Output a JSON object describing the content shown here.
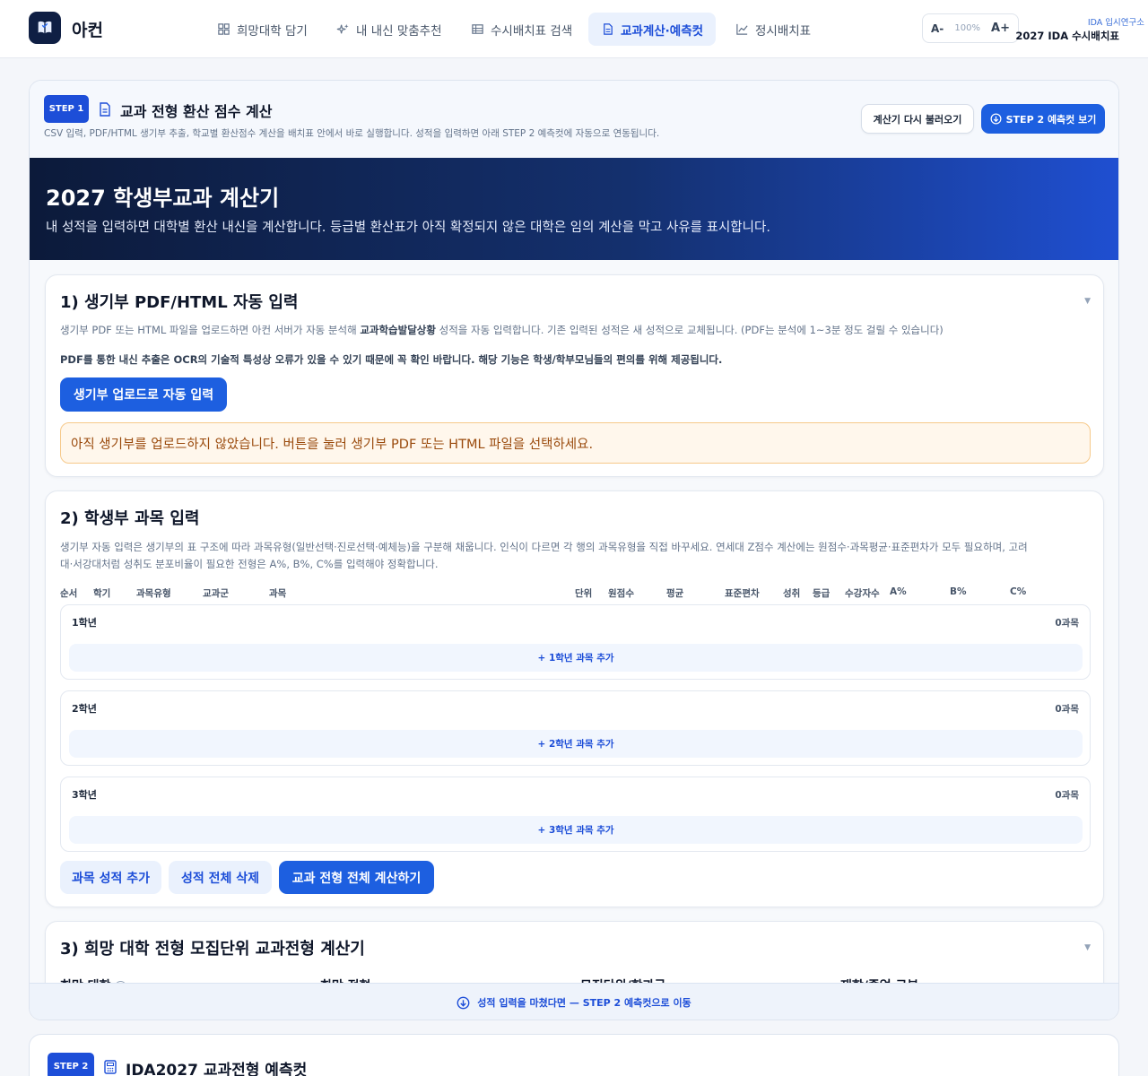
{
  "header": {
    "app_name": "아컨",
    "nav": [
      {
        "label": "희망대학 담기",
        "icon": "grid-icon"
      },
      {
        "label": "내 내신 맞춤추천",
        "icon": "sparkle-icon"
      },
      {
        "label": "수시배치표 검색",
        "icon": "table-icon"
      },
      {
        "label": "교과계산·예측컷",
        "icon": "document-calc-icon",
        "active": true
      },
      {
        "label": "정시배치표",
        "icon": "line-chart-icon"
      }
    ],
    "zoom": {
      "decrease": "A-",
      "value": "100%",
      "increase": "A+"
    },
    "brand_sub": "IDA 입시연구소",
    "brand_main": "2027 IDA 수시배치표"
  },
  "step1": {
    "badge": "STEP 1",
    "title": "교과 전형 환산 점수 계산",
    "desc": "CSV 입력, PDF/HTML 생기부 추출, 학교별 환산점수 계산을 배치표 안에서 바로 실행합니다. 성적을 입력하면 아래 STEP 2 예측컷에 자동으로 연동됩니다.",
    "reload_button": "계산기 다시 불러오기",
    "step2_button": "STEP 2 예측컷 보기"
  },
  "hero": {
    "title": "2027 학생부교과 계산기",
    "desc": "내 성적을 입력하면 대학별 환산 내신을 계산합니다. 등급별 환산표가 아직 확정되지 않은 대학은 임의 계산을 막고 사유를 표시합니다."
  },
  "section1": {
    "title": "1) 생기부 PDF/HTML 자동 입력",
    "desc_pre": "생기부 PDF 또는 HTML 파일을 업로드하면 아컨 서버가 자동 분석해 ",
    "desc_bold": "교과학습발달상황",
    "desc_post": " 성적을 자동 입력합니다. 기존 입력된 성적은 새 성적으로 교체됩니다. (PDF는 분석에 1~3분 정도 걸릴 수 있습니다)",
    "note": "PDF를 통한 내신 추출은 OCR의 기술적 특성상 오류가 있을 수 있기 때문에 꼭 확인 바랍니다. 해당 기능은 학생/학부모님들의 편의를 위해 제공됩니다.",
    "upload_button": "생기부 업로드로 자동 입력",
    "alert": "아직 생기부를 업로드하지 않았습니다. 버튼을 눌러 생기부 PDF 또는 HTML 파일을 선택하세요."
  },
  "section2": {
    "title": "2) 학생부 과목 입력",
    "desc_line1": "생기부 자동 입력은 생기부의 표 구조에 따라 과목유형(일반선택·진로선택·예체능)을 구분해 채웁니다. 인식이 다르면 각 행의 과목유형을 직접 바꾸세요. 연세대 Z점수 계산에는 원점수·과목평균·표준편차가 모두 필요하며, 고려",
    "desc_line2": "대·서강대처럼 성취도 분포비율이 필요한 전형은 A%, B%, C%를 입력해야 정확합니다.",
    "columns": [
      "순서",
      "학기",
      "과목유형",
      "교과군",
      "과목",
      "단위",
      "원점수",
      "평균",
      "표준편차",
      "성취",
      "등급",
      "수강자수",
      "A%",
      "B%",
      "C%"
    ],
    "grades": [
      {
        "label": "1학년",
        "count": "0과목",
        "add": "+ 1학년 과목 추가"
      },
      {
        "label": "2학년",
        "count": "0과목",
        "add": "+ 2학년 과목 추가"
      },
      {
        "label": "3학년",
        "count": "0과목",
        "add": "+ 3학년 과목 추가"
      }
    ],
    "add_button": "과목 성적 추가",
    "clear_button": "성적 전체 삭제",
    "calc_button": "교과 전형 전체 계산하기"
  },
  "section3": {
    "title": "3) 희망 대학 전형 모집단위 교과전형 계산기",
    "fields": [
      "희망 대학",
      "희망 전형",
      "모집단위/학과군",
      "재학/졸업 구분"
    ]
  },
  "bottom_bar": "성적 입력을 마쳤다면 — STEP 2 예측컷으로 이동",
  "step2": {
    "badge": "STEP 2",
    "title": "IDA2027 교과전형 예측컷"
  },
  "colors": {
    "accent": "#1d5fe0",
    "navy": "#0f1f44",
    "alert_bg": "#fff7ec"
  }
}
